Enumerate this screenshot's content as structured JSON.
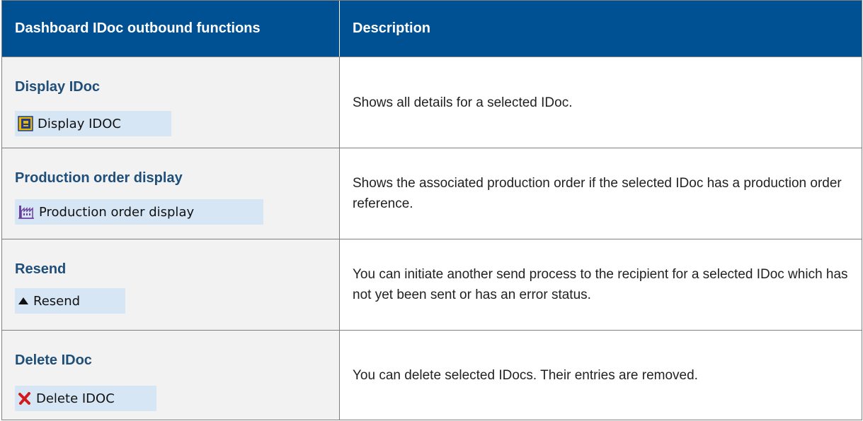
{
  "table": {
    "header": {
      "functions": "Dashboard IDoc outbound functions",
      "description": "Description"
    },
    "rows": [
      {
        "title": "Display IDoc",
        "button_label": "Display IDOC",
        "icon": "display-idoc-icon",
        "description": "Shows all details for a selected IDoc."
      },
      {
        "title": "Production order display",
        "button_label": "Production order display",
        "icon": "factory-icon",
        "description": "Shows the associated production order if the selected IDoc has a production order reference."
      },
      {
        "title": "Resend",
        "button_label": "Resend",
        "icon": "up-triangle-icon",
        "description": "You can initiate another send process to the recipient for a selected IDoc which has not yet been sent or has an error status."
      },
      {
        "title": "Delete IDoc",
        "button_label": "Delete IDOC",
        "icon": "red-x-icon",
        "description": "You can delete selected IDocs. Their entries are removed."
      }
    ]
  },
  "colors": {
    "header_bg": "#005193",
    "title_text": "#1f4e79",
    "button_bg": "#d6e6f5",
    "row_left_bg": "#f2f2f2"
  }
}
